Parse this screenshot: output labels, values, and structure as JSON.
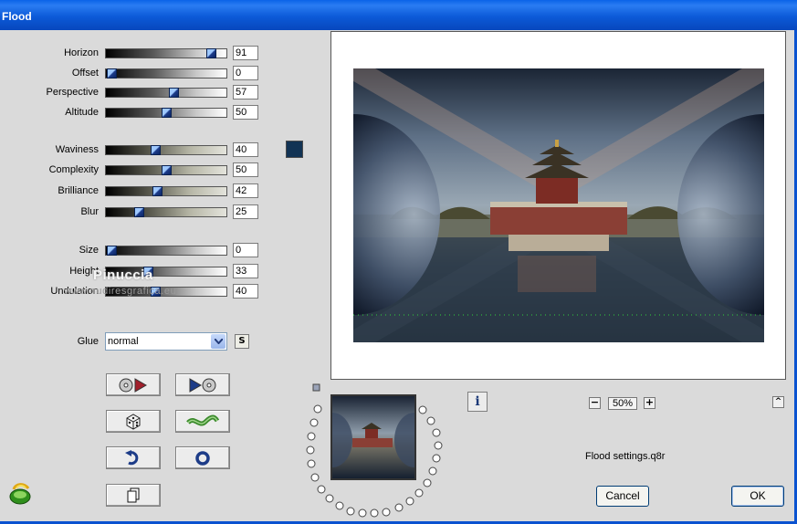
{
  "window": {
    "title": "Flood"
  },
  "params": [
    {
      "id": "horizon",
      "label": "Horizon",
      "value": "91",
      "fraction": 0.91,
      "track": "gray"
    },
    {
      "id": "offset",
      "label": "Offset",
      "value": "0",
      "fraction": 0.0,
      "track": "gray"
    },
    {
      "id": "perspective",
      "label": "Perspective",
      "value": "57",
      "fraction": 0.57,
      "track": "gray"
    },
    {
      "id": "altitude",
      "label": "Altitude",
      "value": "50",
      "fraction": 0.5,
      "track": "gray"
    },
    {
      "id": "waviness",
      "label": "Waviness",
      "value": "40",
      "fraction": 0.4,
      "track": "olive"
    },
    {
      "id": "complexity",
      "label": "Complexity",
      "value": "50",
      "fraction": 0.5,
      "track": "olive"
    },
    {
      "id": "brilliance",
      "label": "Brilliance",
      "value": "42",
      "fraction": 0.42,
      "track": "olive"
    },
    {
      "id": "blur",
      "label": "Blur",
      "value": "25",
      "fraction": 0.25,
      "track": "olive"
    },
    {
      "id": "size",
      "label": "Size",
      "value": "0",
      "fraction": 0.0,
      "track": "gray"
    },
    {
      "id": "height",
      "label": "Height",
      "value": "33",
      "fraction": 0.33,
      "track": "gray"
    },
    {
      "id": "undulation",
      "label": "Undulation",
      "value": "40",
      "fraction": 0.4,
      "track": "gray"
    }
  ],
  "color_swatch": {
    "color": "#123354"
  },
  "watermark": {
    "name": "Pinuccia",
    "site": "www.nudiresgrafica.eu"
  },
  "glue": {
    "label": "Glue",
    "value": "normal",
    "s_button": "S"
  },
  "tool_buttons": [
    {
      "id": "randomize",
      "icon": "dice-icon"
    },
    {
      "id": "previous",
      "icon": "play-back-icon"
    },
    {
      "id": "next",
      "icon": "play-forward-icon"
    },
    {
      "id": "wave",
      "icon": "wave-icon"
    },
    {
      "id": "undo",
      "icon": "undo-arrow-icon"
    },
    {
      "id": "reset",
      "icon": "ring-icon"
    },
    {
      "id": "copy",
      "icon": "copy-icon"
    }
  ],
  "zoom": {
    "value": "50%",
    "minus": "−",
    "plus": "+"
  },
  "info": {
    "label": "i"
  },
  "settings_file": "Flood settings.q8r",
  "buttons": {
    "cancel": "Cancel",
    "ok": "OK"
  },
  "collapse": {
    "label": "^"
  }
}
